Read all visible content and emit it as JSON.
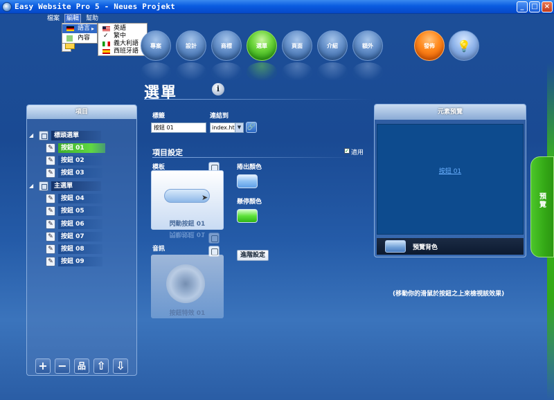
{
  "window": {
    "title": "Easy Website Pro 5 - Neues Projekt",
    "minimize_label": "_",
    "maximize_label": "□",
    "close_label": "×"
  },
  "menubar": {
    "items": [
      "檔案",
      "編輯",
      "幫助"
    ]
  },
  "menus": {
    "edit_menu": {
      "items": [
        "語言",
        "內容"
      ],
      "submenu_arrow": "▸"
    },
    "language_menu": {
      "check_mark": "✓",
      "items": [
        {
          "label": "英語",
          "flag": "us"
        },
        {
          "label": "繁中",
          "checked": true
        },
        {
          "label": "義大利語",
          "flag": "it"
        },
        {
          "label": "西班牙語",
          "flag": "es"
        }
      ]
    }
  },
  "nav": {
    "items": [
      "專案",
      "設計",
      "商標",
      "選單",
      "頁面",
      "介紹",
      "額外"
    ],
    "active": "選單",
    "publish": "發佈",
    "bulb_icon": "💡"
  },
  "page": {
    "title": "選單",
    "info_label": "i"
  },
  "left_panel": {
    "header": "項目",
    "expand_glyph": "◢",
    "edit_glyph": "✎",
    "groups": [
      {
        "label": "標頭選單",
        "items": [
          "按鈕 01",
          "按鈕 02",
          "按鈕 03"
        ]
      },
      {
        "label": "主選單",
        "items": [
          "按鈕 04",
          "按鈕 05",
          "按鈕 06",
          "按鈕 07",
          "按鈕 08",
          "按鈕 09"
        ]
      }
    ],
    "selected_item": "按鈕 01",
    "tools": {
      "add": "+",
      "remove": "−",
      "tree": "品",
      "up": "⇧",
      "down": "⇩"
    }
  },
  "editor": {
    "label_field": {
      "label": "標籤",
      "value": "按鈕 01"
    },
    "link_field": {
      "label": "連結到",
      "value": "index.html",
      "arrow": "▼",
      "link_icon": "🔗"
    },
    "settings_title": "項目設定",
    "apply_label": "適用",
    "apply_checked": true,
    "template_label": "模板",
    "template_caption": "閃動按鈕 01",
    "sound_label": "音訊",
    "sound_caption": "按鈕特效 01",
    "rollout_color_label": "捲出顏色",
    "hover_color_label": "懸停顏色",
    "advanced_button": "進階設定",
    "cursor_glyph": "➤",
    "colors": {
      "rollout": "#8ec1f4",
      "hover": "#5ee23a"
    }
  },
  "preview": {
    "header": "元素預覽",
    "link_text": "按鈕 01",
    "bg_label": "預覽背色",
    "hint": "(移動你的滑鼠於按鈕之上來檢視該效果)"
  },
  "side_tab": {
    "label": "預覽"
  }
}
